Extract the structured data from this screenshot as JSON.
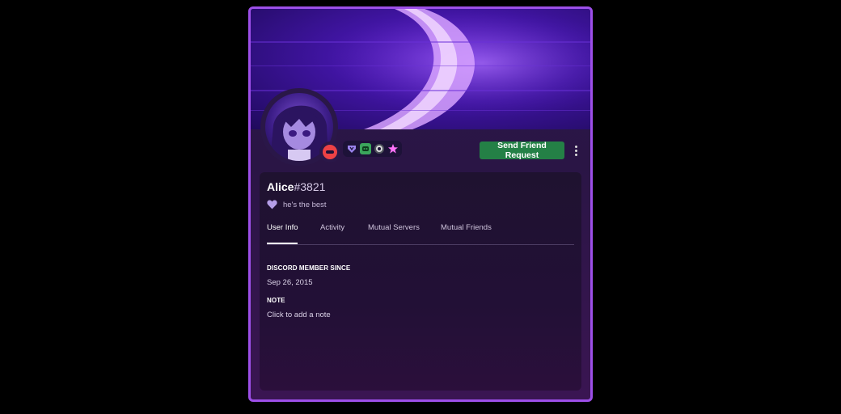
{
  "profile": {
    "username": "Alice",
    "discriminator": "#3821",
    "custom_status": "he's the best",
    "status_emoji": "purple-heart-icon",
    "presence": "do-not-disturb",
    "badges": [
      "hypesquad-badge-icon",
      "nitro-badge-icon",
      "boost-badge-icon",
      "early-supporter-badge-icon"
    ]
  },
  "actions": {
    "send_friend_request": "Send Friend Request",
    "more": "more-options-icon"
  },
  "tabs": [
    {
      "label": "User Info",
      "active": true
    },
    {
      "label": "Activity",
      "active": false
    },
    {
      "label": "Mutual Servers",
      "active": false
    },
    {
      "label": "Mutual Friends",
      "active": false
    }
  ],
  "info": {
    "member_since_heading": "DISCORD MEMBER SINCE",
    "member_since_value": "Sep 26, 2015",
    "note_heading": "NOTE",
    "note_placeholder": "Click to add a note"
  },
  "colors": {
    "accent_border": "#9d4fe8",
    "friend_button": "#248046",
    "dnd": "#ed4245"
  }
}
